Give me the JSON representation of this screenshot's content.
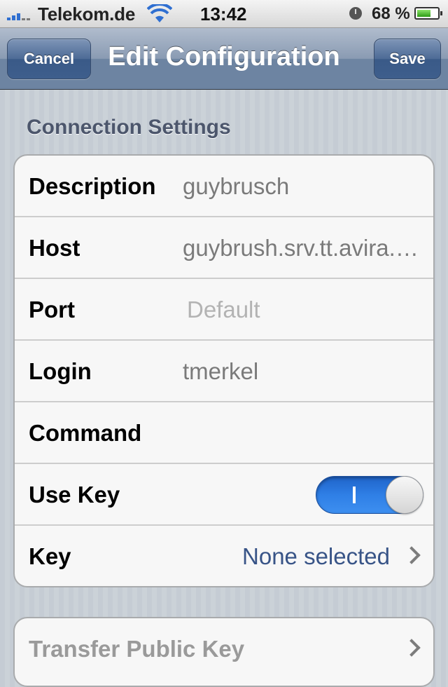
{
  "status_bar": {
    "carrier": "Telekom.de",
    "time": "13:42",
    "battery_percent": "68 %",
    "battery_level": 0.68,
    "icons": [
      "signal-icon",
      "wifi-icon",
      "clock-icon",
      "battery-icon"
    ]
  },
  "nav": {
    "title": "Edit Configuration",
    "cancel_label": "Cancel",
    "save_label": "Save"
  },
  "section": {
    "header": "Connection Settings"
  },
  "rows": {
    "description": {
      "label": "Description",
      "value": "guybrusch"
    },
    "host": {
      "label": "Host",
      "value": "guybrush.srv.tt.avira.com"
    },
    "port": {
      "label": "Port",
      "placeholder": "Default"
    },
    "login": {
      "label": "Login",
      "value": "tmerkel"
    },
    "command": {
      "label": "Command",
      "value": ""
    },
    "use_key": {
      "label": "Use Key",
      "on": true
    },
    "key": {
      "label": "Key",
      "value": "None selected"
    }
  },
  "second_group": {
    "transfer_label": "Transfer Public Key"
  },
  "colors": {
    "accent_blue": "#2f7fe6",
    "link_value": "#385487",
    "nav_bar": "#6d84a2"
  }
}
